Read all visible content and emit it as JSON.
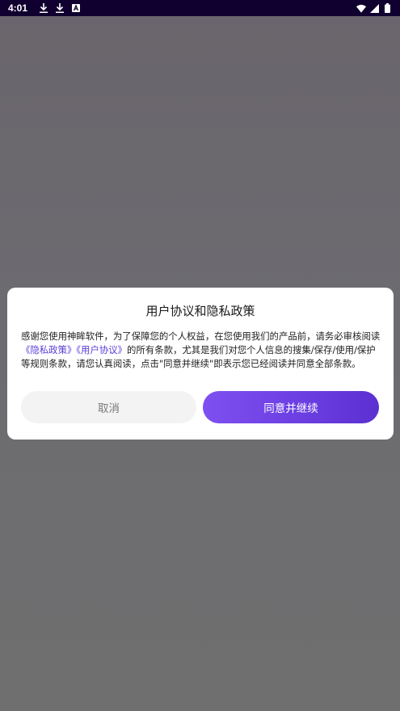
{
  "status_bar": {
    "time": "4:01",
    "background": "#10002f",
    "left_icons": [
      "download-icon",
      "download-icon",
      "font-a-icon"
    ],
    "right_icons": [
      "wifi-icon",
      "signal-icon",
      "battery-icon"
    ]
  },
  "dialog": {
    "title": "用户协议和隐私政策",
    "body_intro": "感谢您使用神眸软件，为了保障您的个人权益，在您使用我们的产品前，请务必审核阅读",
    "privacy_link": "《隐私政策》",
    "terms_link": "《用户协议》",
    "body_outro": "的所有条款，尤其是我们对您个人信息的搜集/保存/使用/保护等规则条款，请您认真阅读，点击\"同意并继续\"即表示您已经阅读并同意全部条款。",
    "cancel_label": "取消",
    "agree_label": "同意并继续",
    "accent_color": "#6c3fe2"
  }
}
